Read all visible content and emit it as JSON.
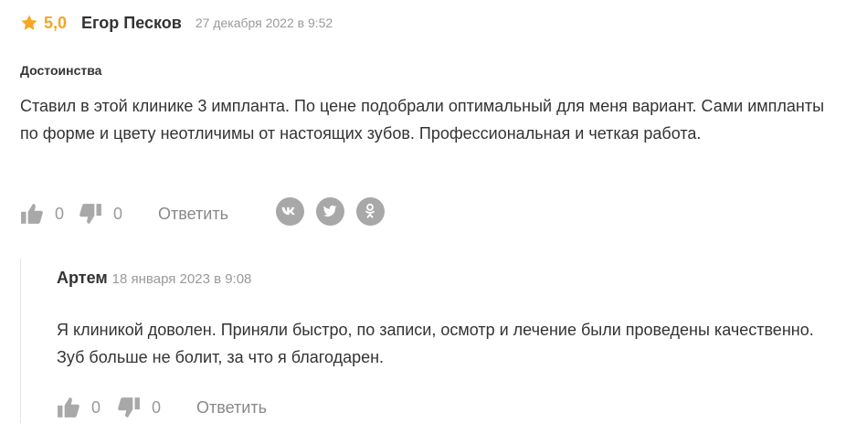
{
  "review": {
    "rating": "5,0",
    "author": "Егор Песков",
    "date": "27 декабря 2022 в 9:52",
    "section_title": "Достоинства",
    "text": "Ставил в этой клинике 3 импланта. По цене подобрали оптимальный для меня вариант. Сами импланты по форме и цвету неотличимы от настоящих зубов. Профессиональная и четкая работа.",
    "likes": "0",
    "dislikes": "0",
    "reply_label": "Ответить",
    "share_icons": [
      "vk-icon",
      "twitter-icon",
      "odnoklassniki-icon"
    ]
  },
  "reply": {
    "author": "Артем",
    "date": "18 января 2023 в 9:08",
    "text": "Я клиникой доволен. Приняли быстро, по записи, осмотр и лечение были проведены качественно. Зуб больше не болит, за что я благодарен.",
    "likes": "0",
    "dislikes": "0",
    "reply_label": "Ответить"
  },
  "colors": {
    "accent_star": "#f5a623",
    "text": "#333333",
    "muted": "#9a9a9a",
    "icon_gray": "#a8a8a8"
  }
}
